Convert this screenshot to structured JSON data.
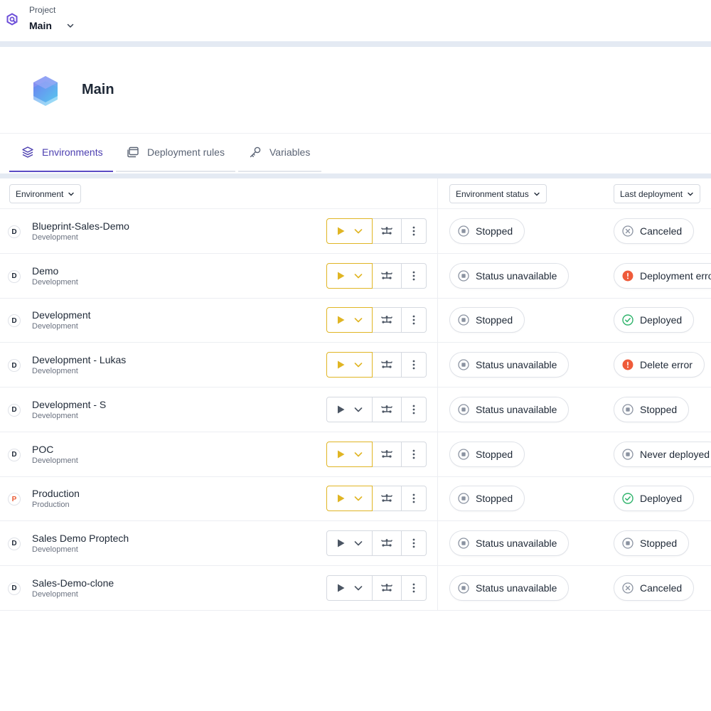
{
  "topbar": {
    "project_label": "Project",
    "project_name": "Main"
  },
  "header": {
    "title": "Main"
  },
  "tabs": [
    {
      "label": "Environments",
      "icon": "layers-icon",
      "active": true
    },
    {
      "label": "Deployment rules",
      "icon": "windows-icon",
      "active": false
    },
    {
      "label": "Variables",
      "icon": "key-icon",
      "active": false
    }
  ],
  "columns": {
    "environment": "Environment",
    "environment_status": "Environment status",
    "last_deployment": "Last deployment"
  },
  "colors": {
    "accent": "#5b4bc4",
    "deploy_active": "#e0b524",
    "error": "#ef5b3a",
    "success": "#2fb36b",
    "muted": "#8b93a1"
  },
  "rows": [
    {
      "badge": "D",
      "name": "Blueprint-Sales-Demo",
      "type": "Development",
      "deploy_active": true,
      "env_status": "Stopped",
      "env_status_icon": "stop-icon",
      "last_deploy": "Canceled",
      "last_deploy_icon": "cancel-icon"
    },
    {
      "badge": "D",
      "name": "Demo",
      "type": "Development",
      "deploy_active": true,
      "env_status": "Status unavailable",
      "env_status_icon": "stop-icon",
      "last_deploy": "Deployment erro",
      "last_deploy_icon": "error-icon"
    },
    {
      "badge": "D",
      "name": "Development",
      "type": "Development",
      "deploy_active": true,
      "env_status": "Stopped",
      "env_status_icon": "stop-icon",
      "last_deploy": "Deployed",
      "last_deploy_icon": "check-icon"
    },
    {
      "badge": "D",
      "name": "Development - Lukas",
      "type": "Development",
      "deploy_active": true,
      "env_status": "Status unavailable",
      "env_status_icon": "stop-icon",
      "last_deploy": "Delete error",
      "last_deploy_icon": "error-icon"
    },
    {
      "badge": "D",
      "name": "Development - S",
      "type": "Development",
      "deploy_active": false,
      "env_status": "Status unavailable",
      "env_status_icon": "stop-icon",
      "last_deploy": "Stopped",
      "last_deploy_icon": "stop-icon"
    },
    {
      "badge": "D",
      "name": "POC",
      "type": "Development",
      "deploy_active": true,
      "env_status": "Stopped",
      "env_status_icon": "stop-icon",
      "last_deploy": "Never deployed",
      "last_deploy_icon": "stop-icon"
    },
    {
      "badge": "P",
      "name": "Production",
      "type": "Production",
      "deploy_active": true,
      "env_status": "Stopped",
      "env_status_icon": "stop-icon",
      "last_deploy": "Deployed",
      "last_deploy_icon": "check-icon"
    },
    {
      "badge": "D",
      "name": "Sales Demo Proptech",
      "type": "Development",
      "deploy_active": false,
      "env_status": "Status unavailable",
      "env_status_icon": "stop-icon",
      "last_deploy": "Stopped",
      "last_deploy_icon": "stop-icon"
    },
    {
      "badge": "D",
      "name": "Sales-Demo-clone",
      "type": "Development",
      "deploy_active": false,
      "env_status": "Status unavailable",
      "env_status_icon": "stop-icon",
      "last_deploy": "Canceled",
      "last_deploy_icon": "cancel-icon"
    }
  ]
}
